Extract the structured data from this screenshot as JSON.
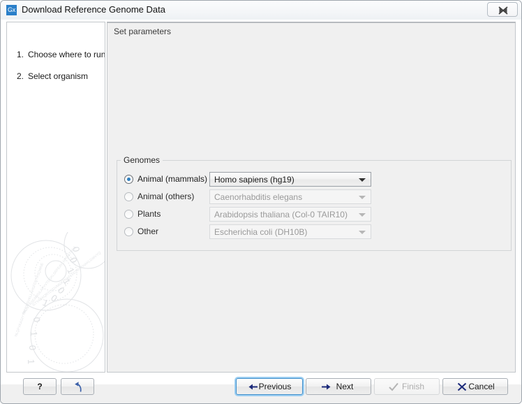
{
  "window": {
    "title": "Download Reference Genome Data",
    "app_icon_text": "Gx",
    "close_icon": "close-icon"
  },
  "steps": {
    "items": [
      {
        "number": "1.",
        "label": "Choose where to run"
      },
      {
        "number": "2.",
        "label": "Select organism"
      }
    ]
  },
  "params": {
    "header": "Set parameters",
    "genomes": {
      "legend": "Genomes",
      "rows": [
        {
          "label": "Animal (mammals)",
          "selected": true,
          "enabled": true,
          "value": "Homo sapiens (hg19)"
        },
        {
          "label": "Animal (others)",
          "selected": false,
          "enabled": false,
          "value": "Caenorhabditis elegans"
        },
        {
          "label": "Plants",
          "selected": false,
          "enabled": false,
          "value": "Arabidopsis thaliana (Col-0 TAIR10)"
        },
        {
          "label": "Other",
          "selected": false,
          "enabled": false,
          "value": "Escherichia coli (DH10B)"
        }
      ]
    }
  },
  "footer": {
    "help_label": "?",
    "reset_icon": "undo-arrow-icon",
    "previous_label": "Previous",
    "next_label": "Next",
    "finish_label": "Finish",
    "cancel_label": "Cancel"
  },
  "colors": {
    "accent_blue": "#2f7fbf",
    "focus_blue": "#3f8ecb",
    "icon_navy": "#1c2a7a",
    "disabled_grey": "#adadad"
  }
}
